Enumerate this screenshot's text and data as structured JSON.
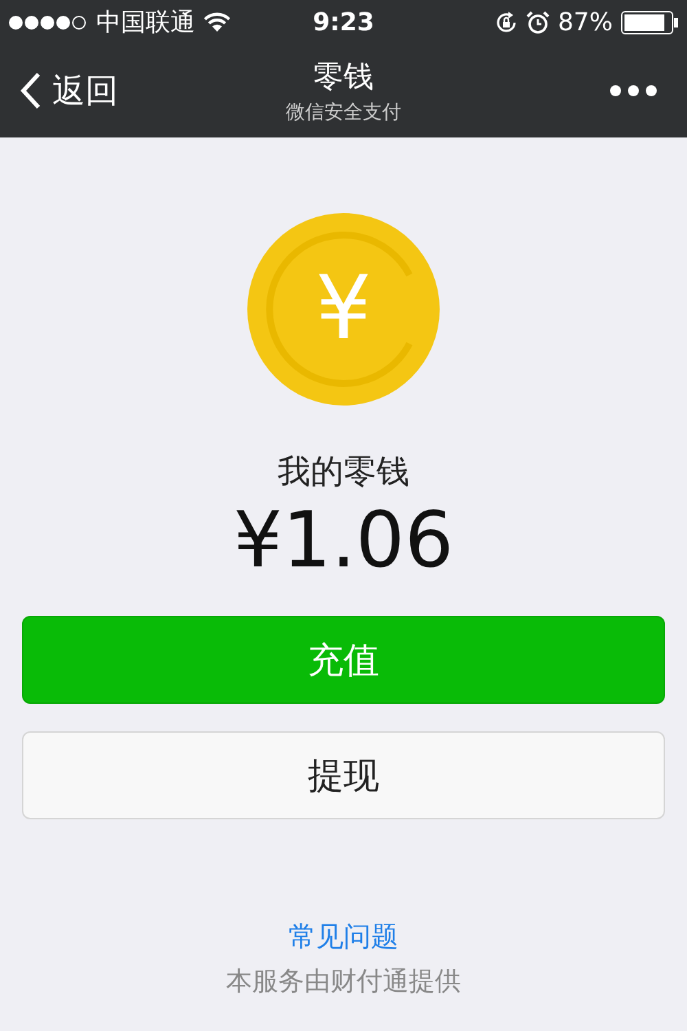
{
  "status_bar": {
    "carrier": "中国联通",
    "time": "9:23",
    "battery": "87%"
  },
  "nav": {
    "back": "返回",
    "title": "零钱",
    "subtitle": "微信安全支付"
  },
  "balance": {
    "label": "我的零钱",
    "amount": "¥1.06",
    "symbol": "¥"
  },
  "buttons": [
    {
      "label": "充值",
      "kind": "primary"
    },
    {
      "label": "提现",
      "kind": "secondary"
    }
  ],
  "footer": {
    "link": "常见问题",
    "note": "本服务由财付通提供"
  }
}
